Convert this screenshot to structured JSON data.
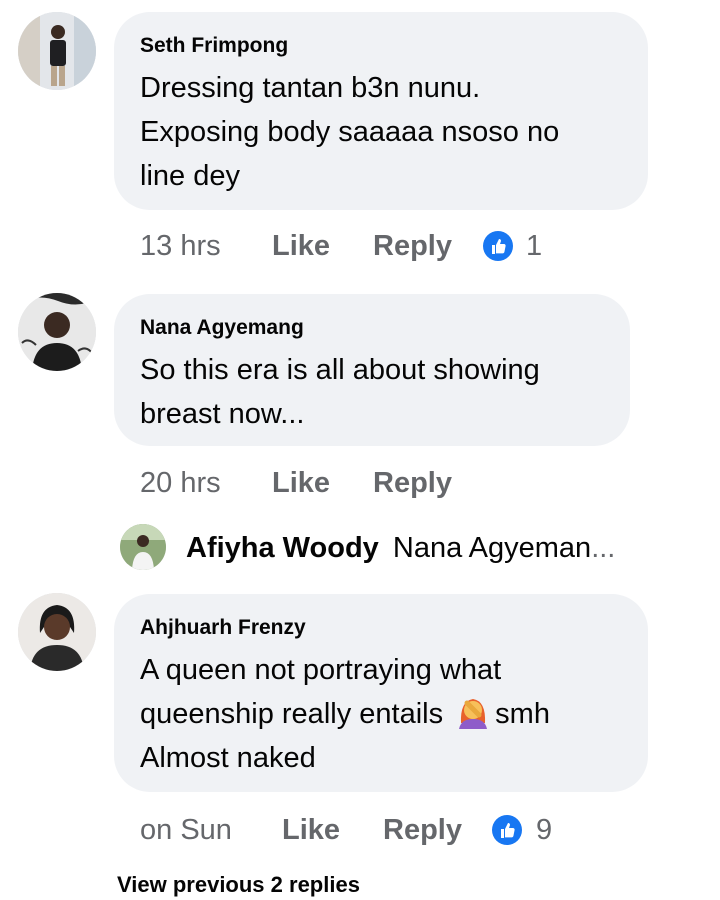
{
  "comments": [
    {
      "author": "Seth Frimpong",
      "lines": [
        "Dressing tantan b3n nunu.",
        "Exposing body saaaaa nsoso no",
        "line dey"
      ],
      "time": "13 hrs",
      "like_label": "Like",
      "reply_label": "Reply",
      "reaction_icon": "like-icon",
      "reaction_count": "1"
    },
    {
      "author": "Nana Agyemang",
      "lines": [
        "So this era is all about showing",
        "breast now..."
      ],
      "time": "20 hrs",
      "like_label": "Like",
      "reply_label": "Reply"
    },
    {
      "author": "Ahjhuarh Frenzy",
      "lines": [
        "A queen not portraying what",
        "queenship really entails",
        "smh",
        "Almost naked"
      ],
      "emoji": "facepalm-woman-emoji",
      "time": "on Sun",
      "like_label": "Like",
      "reply_label": "Reply",
      "reaction_icon": "like-icon",
      "reaction_count": "9"
    }
  ],
  "reply_preview": {
    "author": "Afiyha Woody",
    "text": "Nana Agyeman",
    "ellipsis": "..."
  },
  "view_previous": "View previous 2 replies",
  "colors": {
    "bubble": "#f0f2f5",
    "meta": "#65676b",
    "like_blue": "#1877f2",
    "text": "#050505"
  }
}
